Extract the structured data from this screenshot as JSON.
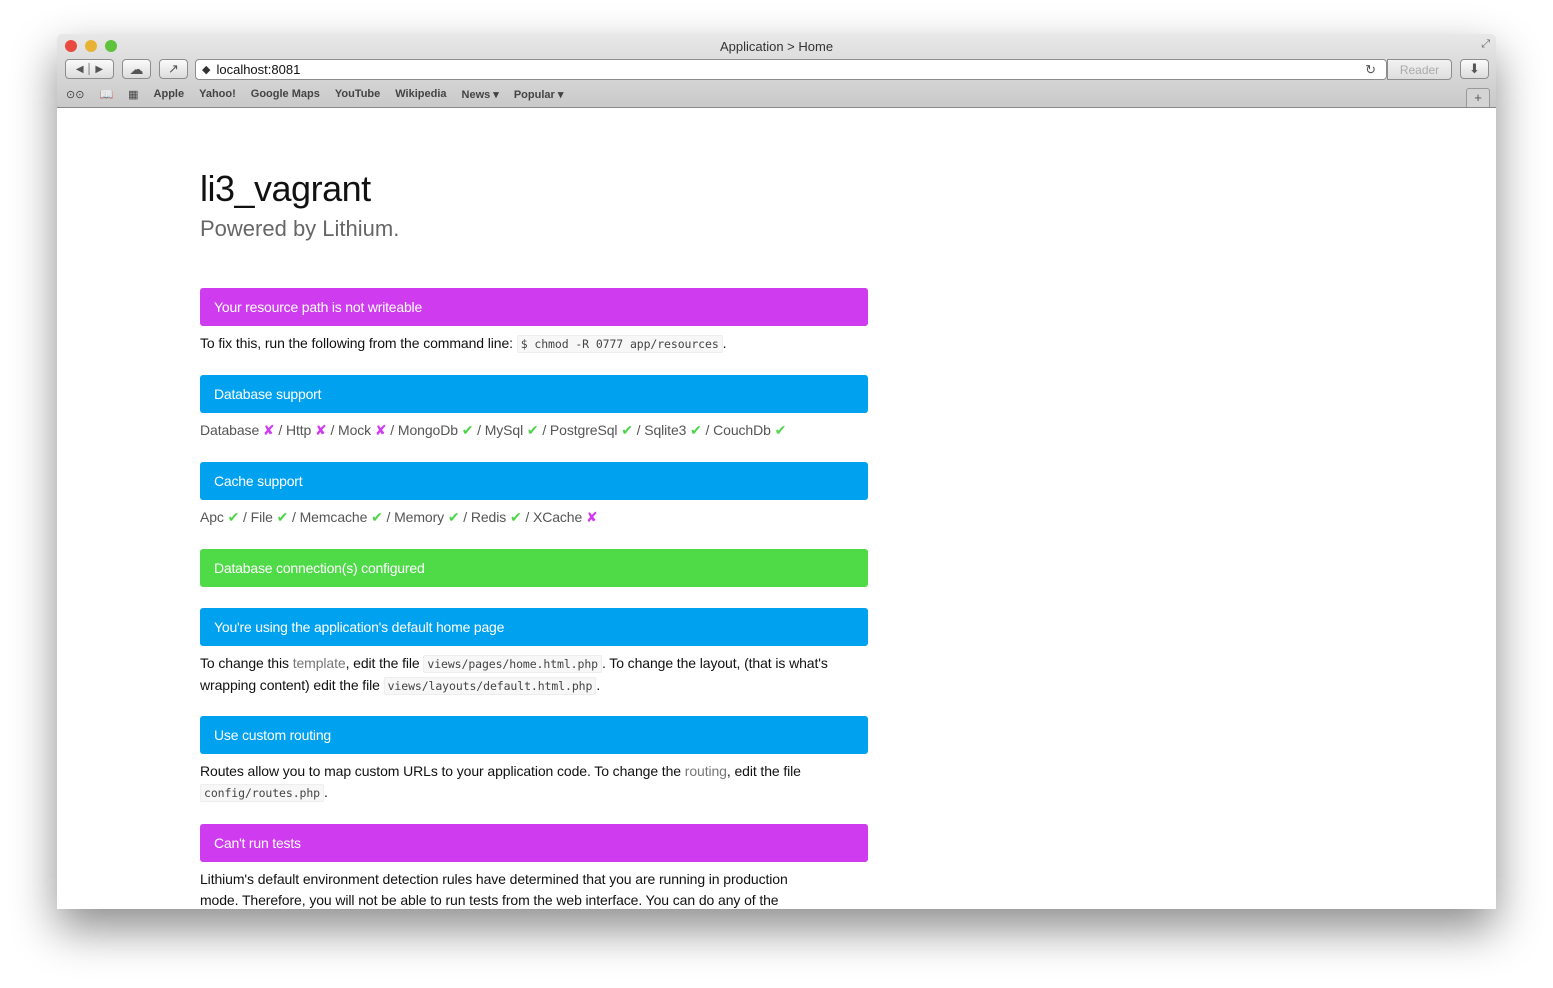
{
  "window": {
    "title": "Application > Home"
  },
  "toolbar": {
    "url": "localhost:8081",
    "reader_label": "Reader"
  },
  "bookmarks": [
    "Apple",
    "Yahoo!",
    "Google Maps",
    "YouTube",
    "Wikipedia",
    "News ▾",
    "Popular ▾"
  ],
  "colors": {
    "magenta": "#cf3bef",
    "blue": "#00a1ef",
    "green": "#4fda48"
  },
  "page": {
    "title": "li3_vagrant",
    "subtitle": "Powered by Lithium.",
    "resource": {
      "heading": "Your resource path is not writeable",
      "text": "To fix this, run the following from the command line:",
      "code": "$ chmod -R 0777 app/resources",
      "end": "."
    },
    "database": {
      "heading": "Database support",
      "items": [
        {
          "name": "Database",
          "ok": false
        },
        {
          "name": "Http",
          "ok": false
        },
        {
          "name": "Mock",
          "ok": false
        },
        {
          "name": "MongoDb",
          "ok": true
        },
        {
          "name": "MySql",
          "ok": true
        },
        {
          "name": "PostgreSql",
          "ok": true
        },
        {
          "name": "Sqlite3",
          "ok": true
        },
        {
          "name": "CouchDb",
          "ok": true
        }
      ]
    },
    "cache": {
      "heading": "Cache support",
      "items": [
        {
          "name": "Apc",
          "ok": true
        },
        {
          "name": "File",
          "ok": true
        },
        {
          "name": "Memcache",
          "ok": true
        },
        {
          "name": "Memory",
          "ok": true
        },
        {
          "name": "Redis",
          "ok": true
        },
        {
          "name": "XCache",
          "ok": false
        }
      ]
    },
    "connection": {
      "heading": "Database connection(s) configured"
    },
    "home": {
      "heading": "You're using the application's default home page",
      "t1": "To change this ",
      "link": "template",
      "t2": ", edit the file ",
      "code1": "views/pages/home.html.php",
      "t3": ". To change the layout, (that is what's wrapping content) edit the file ",
      "code2": "views/layouts/default.html.php",
      "t4": "."
    },
    "routing": {
      "heading": "Use custom routing",
      "t1": "Routes allow you to map custom URLs to your application code. To change the ",
      "link": "routing",
      "t2": ", edit the file ",
      "code": "config/routes.php",
      "t3": "."
    },
    "tests": {
      "heading": "Can't run tests",
      "text": "Lithium's default environment detection rules have determined that you are running in production mode. Therefore, you will not be able to run tests from the web interface. You can do any of the"
    }
  }
}
